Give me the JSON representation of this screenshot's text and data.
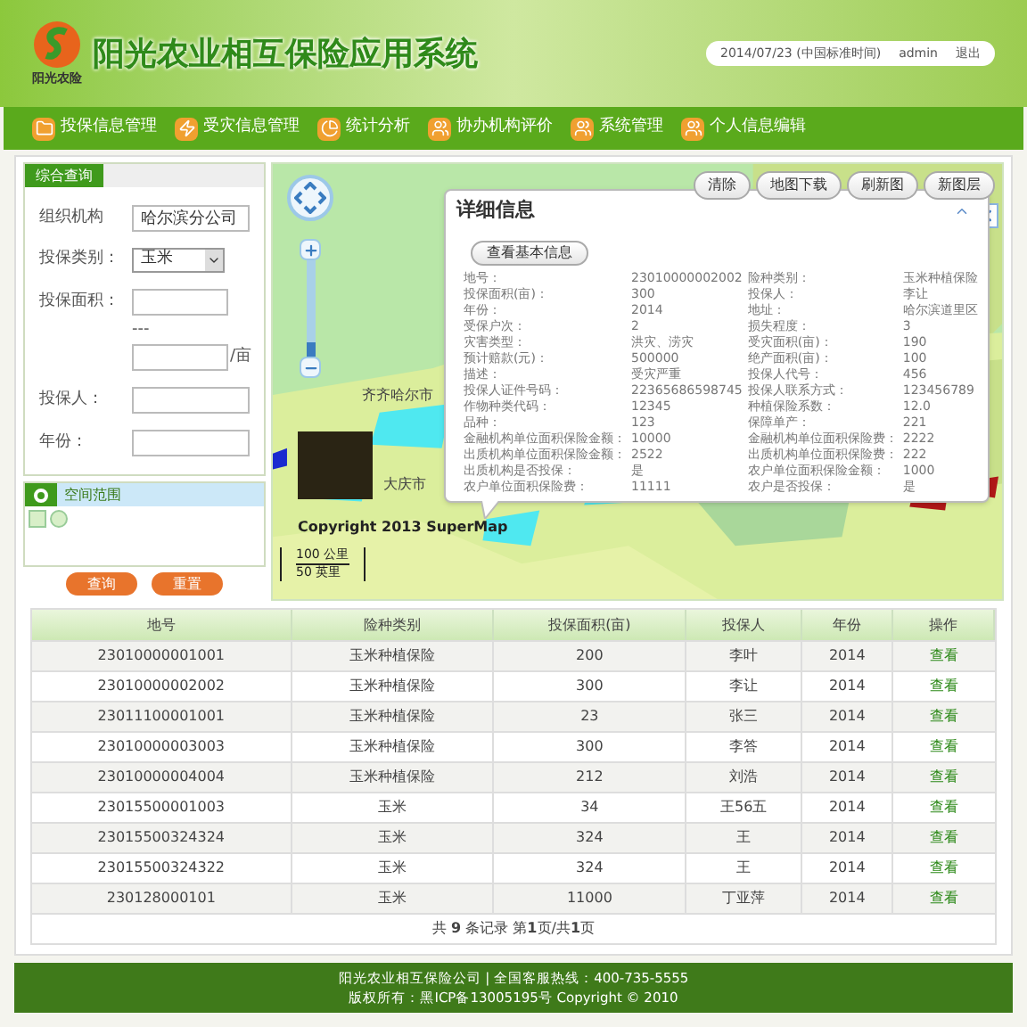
{
  "header": {
    "logo_text": "阳光农险",
    "title": "阳光农业相互保险应用系统",
    "datetime": "2014/07/23 (中国标准时间)",
    "user": "admin",
    "logout": "退出"
  },
  "nav": [
    {
      "label": "投保信息管理",
      "kind": "folder"
    },
    {
      "label": "受灾信息管理",
      "kind": "flash"
    },
    {
      "label": "统计分析",
      "kind": "chart"
    },
    {
      "label": "协办机构评价",
      "kind": "people"
    },
    {
      "label": "系统管理",
      "kind": "people"
    },
    {
      "label": "个人信息编辑",
      "kind": "people"
    }
  ],
  "query_panel": {
    "tab": "综合查询",
    "fields": [
      {
        "label": "组织机构",
        "kind": "text",
        "value": "哈尔滨分公司"
      },
      {
        "label": "投保类别：",
        "kind": "select",
        "value": "玉米"
      },
      {
        "label": "投保面积：",
        "kind": "range",
        "separator": "---",
        "unit": "/亩"
      },
      {
        "label": "投保人：",
        "kind": "text"
      },
      {
        "label": "年份：",
        "kind": "text"
      }
    ]
  },
  "space_panel": {
    "title": "空间范围"
  },
  "buttons": [
    "查询",
    "重置"
  ],
  "map": {
    "zoom": {
      "level": 0.15
    },
    "buttons": [
      "清除",
      "地图下载",
      "刷新图",
      "新图层"
    ],
    "labels": [
      "齐齐哈尔市",
      "大庆市"
    ],
    "copyright": "Copyright 2013 SuperMap",
    "scale": [
      "100 公里",
      "50 英里"
    ],
    "popup": {
      "title": "详细信息",
      "button": "查看基本信息",
      "rows": [
        [
          "地号：",
          "23010000002002",
          "险种类别：",
          "玉米种植保险"
        ],
        [
          "投保面积(亩)：",
          "300",
          "投保人：",
          "李让"
        ],
        [
          "年份：",
          "2014",
          "地址：",
          "哈尔滨道里区"
        ],
        [
          "受保户次：",
          "2",
          "损失程度：",
          "3"
        ],
        [
          "灾害类型：",
          "洪灾、涝灾",
          "受灾面积(亩)：",
          "190"
        ],
        [
          "预计赔款(元)：",
          "500000",
          "绝产面积(亩)：",
          "100"
        ],
        [
          "描述：",
          "受灾严重",
          "投保人代号：",
          "456"
        ],
        [
          "投保人证件号码：",
          "22365686598745",
          "投保人联系方式：",
          "123456789"
        ],
        [
          "作物种类代码：",
          "12345",
          "种植保险系数：",
          "12.0"
        ],
        [
          "品种：",
          "123",
          "保障单产：",
          "221"
        ],
        [
          "金融机构单位面积保险金额：",
          "10000",
          "金融机构单位面积保险费：",
          "2222"
        ],
        [
          "出质机构单位面积保险金额：",
          "2522",
          "出质机构单位面积保险费：",
          "222"
        ],
        [
          "出质机构是否投保：",
          "是",
          "农户单位面积保险金额：",
          "1000"
        ],
        [
          "农户单位面积保险费：",
          "11111",
          "农户是否投保：",
          "是"
        ]
      ]
    }
  },
  "table": {
    "columns": [
      "地号",
      "险种类别",
      "投保面积(亩)",
      "投保人",
      "年份",
      "操作"
    ],
    "rows": [
      [
        "23010000001001",
        "玉米种植保险",
        "200",
        "李叶",
        "2014",
        "查看"
      ],
      [
        "23010000002002",
        "玉米种植保险",
        "300",
        "李让",
        "2014",
        "查看"
      ],
      [
        "23011100001001",
        "玉米种植保险",
        "23",
        "张三",
        "2014",
        "查看"
      ],
      [
        "23010000003003",
        "玉米种植保险",
        "300",
        "李答",
        "2014",
        "查看"
      ],
      [
        "23010000004004",
        "玉米种植保险",
        "212",
        "刘浩",
        "2014",
        "查看"
      ],
      [
        "23015500001003",
        "玉米",
        "34",
        "王56五",
        "2014",
        "查看"
      ],
      [
        "23015500324324",
        "玉米",
        "324",
        "王",
        "2014",
        "查看"
      ],
      [
        "23015500324322",
        "玉米",
        "324",
        "王",
        "2014",
        "查看"
      ],
      [
        "230128000101",
        "玉米",
        "11000",
        "丁亚萍",
        "2014",
        "查看"
      ]
    ],
    "pagination": "共 **9** 条记录 第**1**页/共**1**页"
  },
  "footer": [
    "阳光农业相互保险公司 | 全国客服热线：400-735-5555",
    "版权所有：黑ICP备13005195号 Copyright © 2010"
  ]
}
